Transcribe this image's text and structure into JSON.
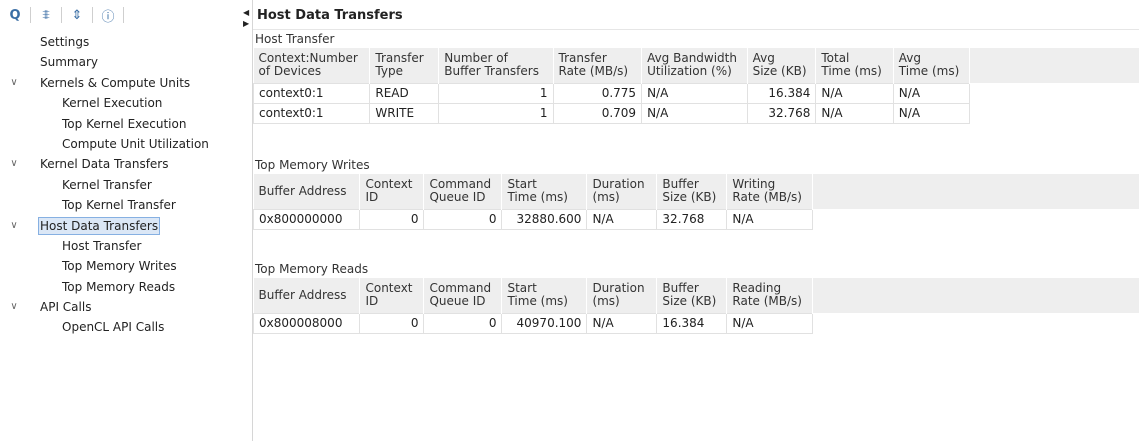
{
  "toolbar": {
    "search": "Q",
    "collapse": "⩨",
    "expand": "⇕",
    "info": "ⓘ"
  },
  "tree": {
    "items": [
      {
        "label": "Settings"
      },
      {
        "label": "Summary"
      },
      {
        "label": "Kernels & Compute Units"
      },
      {
        "label": "Kernel Execution"
      },
      {
        "label": "Top Kernel Execution"
      },
      {
        "label": "Compute Unit Utilization"
      },
      {
        "label": "Kernel Data Transfers"
      },
      {
        "label": "Kernel Transfer"
      },
      {
        "label": "Top Kernel Transfer"
      },
      {
        "label": "Host Data Transfers"
      },
      {
        "label": "Host Transfer"
      },
      {
        "label": "Top Memory Writes"
      },
      {
        "label": "Top Memory Reads"
      },
      {
        "label": "API Calls"
      },
      {
        "label": "OpenCL API Calls"
      }
    ]
  },
  "main": {
    "title": "Host Data Transfers",
    "host_transfer": {
      "heading": "Host Transfer",
      "columns": [
        [
          "Context:Number",
          "of Devices"
        ],
        [
          "Transfer",
          "Type"
        ],
        [
          "Number of",
          "Buffer Transfers"
        ],
        [
          "Transfer",
          "Rate (MB/s)"
        ],
        [
          "Avg Bandwidth",
          "Utilization (%)"
        ],
        [
          "Avg",
          "Size (KB)"
        ],
        [
          "Total",
          "Time (ms)"
        ],
        [
          "Avg",
          "Time (ms)"
        ]
      ],
      "rows": [
        [
          "context0:1",
          "READ",
          "1",
          "0.775",
          "N/A",
          "16.384",
          "N/A",
          "N/A"
        ],
        [
          "context0:1",
          "WRITE",
          "1",
          "0.709",
          "N/A",
          "32.768",
          "N/A",
          "N/A"
        ]
      ]
    },
    "top_writes": {
      "heading": "Top Memory Writes",
      "columns": [
        [
          "Buffer Address",
          ""
        ],
        [
          "Context",
          "ID"
        ],
        [
          "Command",
          "Queue ID"
        ],
        [
          "Start",
          "Time (ms)"
        ],
        [
          "Duration",
          "(ms)"
        ],
        [
          "Buffer",
          "Size (KB)"
        ],
        [
          "Writing",
          "Rate (MB/s)"
        ]
      ],
      "rows": [
        [
          "0x800000000",
          "0",
          "0",
          "32880.600",
          "N/A",
          "32.768",
          "N/A"
        ]
      ]
    },
    "top_reads": {
      "heading": "Top Memory Reads",
      "columns": [
        [
          "Buffer Address",
          ""
        ],
        [
          "Context",
          "ID"
        ],
        [
          "Command",
          "Queue ID"
        ],
        [
          "Start",
          "Time (ms)"
        ],
        [
          "Duration",
          "(ms)"
        ],
        [
          "Buffer",
          "Size (KB)"
        ],
        [
          "Reading",
          "Rate (MB/s)"
        ]
      ],
      "rows": [
        [
          "0x800008000",
          "0",
          "0",
          "40970.100",
          "N/A",
          "16.384",
          "N/A"
        ]
      ]
    }
  }
}
